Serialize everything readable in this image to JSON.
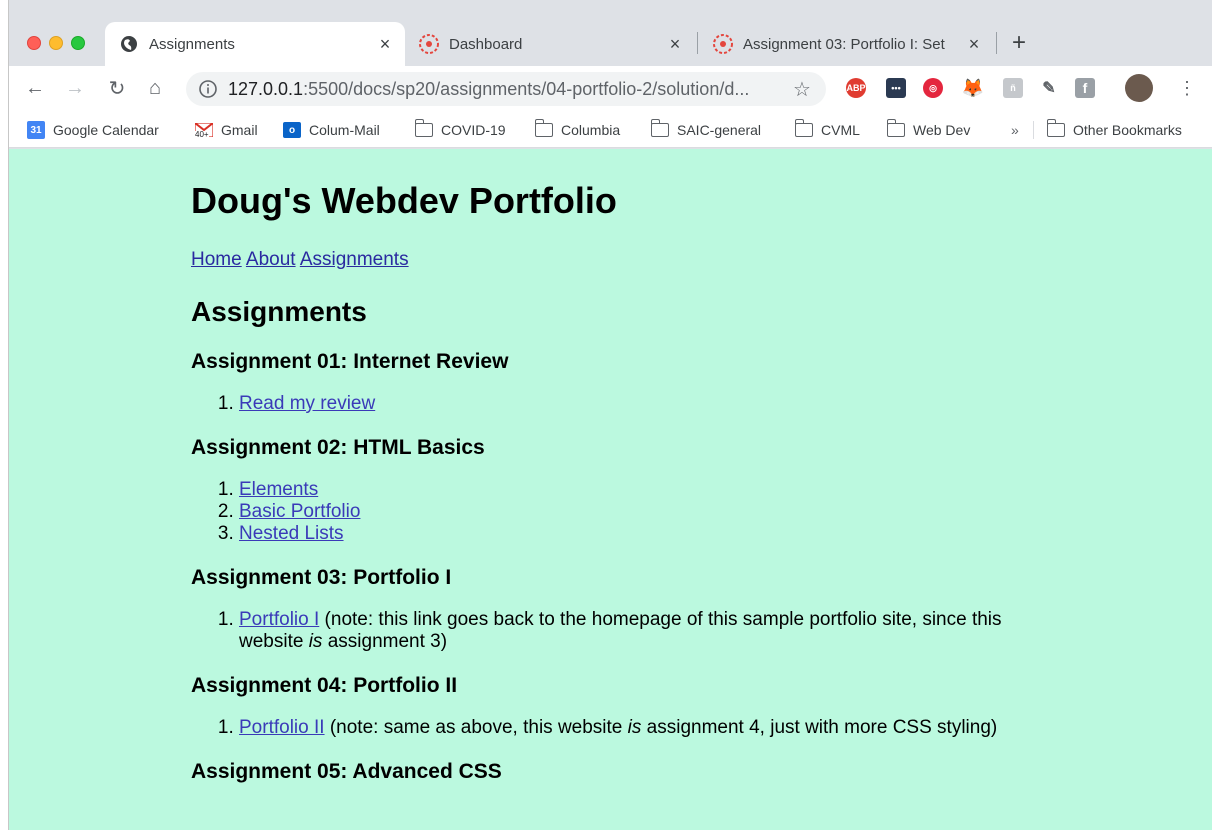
{
  "browser": {
    "tabs": [
      {
        "title": "Assignments",
        "close": "×"
      },
      {
        "title": "Dashboard",
        "close": "×"
      },
      {
        "title": "Assignment 03: Portfolio I: Set",
        "close": "×"
      }
    ],
    "new_tab": "+",
    "url_host": "127.0.0.1",
    "url_path": ":5500/docs/sp20/assignments/04-portfolio-2/solution/d...",
    "bookmarks": [
      {
        "label": "Google Calendar",
        "icon": "calendar-icon"
      },
      {
        "label": "Gmail",
        "icon": "gmail-icon"
      },
      {
        "label": "Colum-Mail",
        "icon": "outlook-icon"
      },
      {
        "label": "COVID-19",
        "icon": "folder-icon"
      },
      {
        "label": "Columbia",
        "icon": "folder-icon"
      },
      {
        "label": "SAIC-general",
        "icon": "folder-icon"
      },
      {
        "label": "CVML",
        "icon": "folder-icon"
      },
      {
        "label": "Web Dev",
        "icon": "folder-icon"
      }
    ],
    "bookmarks_overflow": "»",
    "other_bookmarks": "Other Bookmarks",
    "gmail_badge": "40+",
    "calendar_day": "31"
  },
  "page": {
    "title": "Doug's Webdev Portfolio",
    "nav": [
      "Home",
      "About",
      "Assignments"
    ],
    "heading": "Assignments",
    "a1": {
      "title": "Assignment 01: Internet Review",
      "link": "Read my review"
    },
    "a2": {
      "title": "Assignment 02: HTML Basics",
      "links": [
        "Elements",
        "Basic Portfolio",
        "Nested Lists"
      ]
    },
    "a3": {
      "title": "Assignment 03: Portfolio I",
      "link": "Portfolio I",
      "note_a": " (note: this link goes back to the homepage of this sample portfolio site, since this website ",
      "note_em": "is",
      "note_b": " assignment 3)"
    },
    "a4": {
      "title": "Assignment 04: Portfolio II",
      "link": "Portfolio II",
      "note_a": " (note: same as above, this website ",
      "note_em": "is",
      "note_b": " assignment 4, just with more CSS styling)"
    },
    "a5": {
      "title": "Assignment 05: Advanced CSS"
    }
  }
}
